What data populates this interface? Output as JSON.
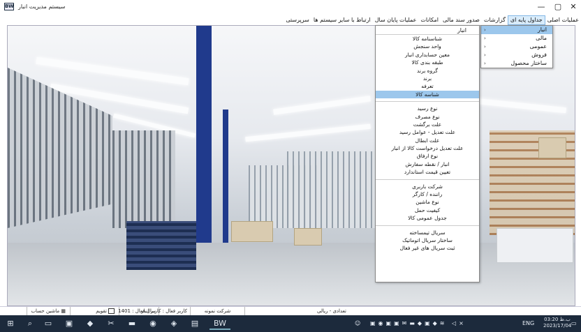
{
  "window": {
    "title": "سیستم مدیریت انبار",
    "icon_text": "BW",
    "controls": {
      "minimize": "—",
      "maximize": "▢",
      "close": "✕"
    }
  },
  "menubar": [
    {
      "label": "عملیات اصلی"
    },
    {
      "label": "جداول پایه ای",
      "active": true
    },
    {
      "label": "گزارشات"
    },
    {
      "label": "صدور سند مالی"
    },
    {
      "label": "امکانات"
    },
    {
      "label": "عملیات پایان سال"
    },
    {
      "label": "ارتباط با سایر سیستم ها"
    },
    {
      "label": "سرپرستی"
    }
  ],
  "submenu": [
    {
      "label": "انبار",
      "highlighted": true
    },
    {
      "label": "مالی"
    },
    {
      "label": "عمومی"
    },
    {
      "label": "فروش"
    },
    {
      "label": "ساختار محصول"
    }
  ],
  "dropdown": {
    "header": "انبار",
    "groups": [
      [
        "شناسنامه کالا",
        "واحد سنجش",
        "معین حسابداری انبار",
        "طبقه بندی کالا",
        "گروه برند",
        "برند",
        "تعرفه",
        "شناسه کالا"
      ],
      [
        "نوع رسید",
        "نوع مصرف",
        "علت برگشت",
        "علت تعدیل - عوامل رسید",
        "علت ابطال",
        "علت تعدیل درخواست کالا از انبار",
        "نوع ارفاق",
        "انبار / نقطه سفارش",
        "تعیین قیمت استاندارد"
      ],
      [
        "شرکت باربری",
        "راننده / کارگر",
        "نوع ماشین",
        "کیفیت حمل",
        "جدول عمومی کالا"
      ],
      [
        "سریال تیمساخته",
        "ساختار سریال اتوماتیک",
        "ثبت سریال های غیر فعال"
      ]
    ],
    "highlighted": "شناسه کالا"
  },
  "statusbar": {
    "currency": "تعدادی - ریالی",
    "company": "شرکت نمونه",
    "user": "کاربر فعال : کاربر انبار",
    "year": "سال فعال : 1401",
    "calendar": "تقویم",
    "calculator": "ماشین حساب"
  },
  "taskbar": {
    "app_label": "BW",
    "lang": "ENG",
    "time": "03:20 ب.ظ",
    "date": "2023/17/04"
  },
  "colors": {
    "accent": "#9cc7ec",
    "column": "#203a8c",
    "taskbar": "#1c2a3c"
  }
}
